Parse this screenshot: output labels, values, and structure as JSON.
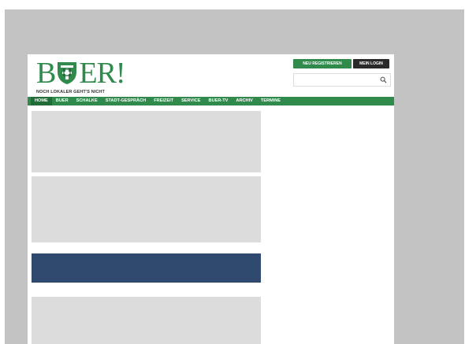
{
  "header": {
    "logo_text_left": "B",
    "logo_text_right": "ER!",
    "tagline": "NOCH LOKALER GEHT'S NICHT",
    "register_button": "NEU REGISTRIEREN",
    "login_button": "MEIN LOGIN",
    "search_placeholder": ""
  },
  "nav": {
    "items": [
      {
        "label": "HOME",
        "active": true
      },
      {
        "label": "BUER"
      },
      {
        "label": "SCHALKE"
      },
      {
        "label": "STADT-GESPRÄCH"
      },
      {
        "label": "FREIZEIT"
      },
      {
        "label": "SERVICE"
      },
      {
        "label": "BUER-TV"
      },
      {
        "label": "ARCHIV"
      },
      {
        "label": "TERMINE"
      }
    ]
  },
  "colors": {
    "brand_green": "#2f8a4c",
    "dark_button": "#2a2a2a",
    "banner_blue": "#2f4a6e",
    "placeholder_grey": "#dcdcdc",
    "backdrop_grey": "#c3c3c3"
  },
  "icons": {
    "search": "search-icon",
    "crest": "coat-of-arms-icon"
  }
}
